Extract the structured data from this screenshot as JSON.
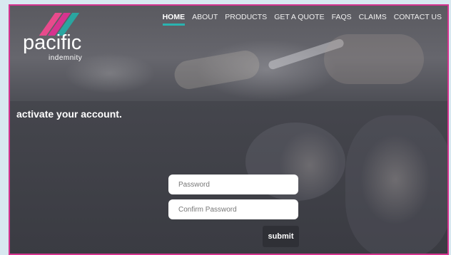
{
  "brand": {
    "name": "pacific",
    "tagline": "indemnity",
    "colors": [
      "#e84a8c",
      "#d6338f",
      "#2aa5a0"
    ]
  },
  "nav": {
    "items": [
      {
        "label": "HOME",
        "active": true
      },
      {
        "label": "ABOUT",
        "active": false
      },
      {
        "label": "PRODUCTS",
        "active": false
      },
      {
        "label": "GET A QUOTE",
        "active": false
      },
      {
        "label": "FAQS",
        "active": false
      },
      {
        "label": "CLAIMS",
        "active": false
      },
      {
        "label": "CONTACT US",
        "active": false
      }
    ]
  },
  "page": {
    "title": "activate your account."
  },
  "form": {
    "password_placeholder": "Password",
    "confirm_placeholder": "Confirm Password",
    "submit_label": "submit"
  },
  "colors": {
    "accent_underline": "#2ab3b0",
    "frame_border": "#d6338f"
  }
}
